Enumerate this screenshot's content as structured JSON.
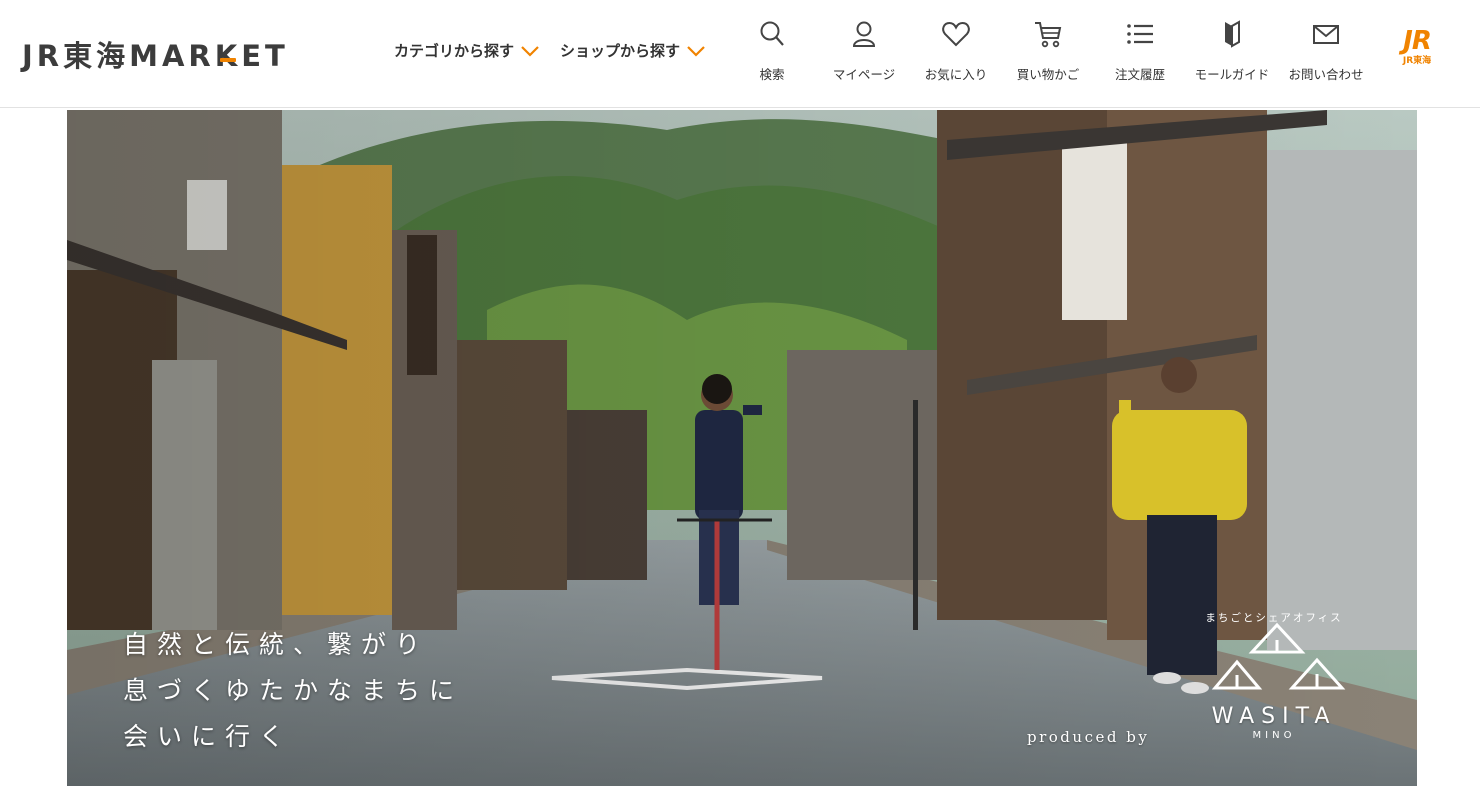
{
  "header": {
    "logo_text": "JR東海MARKET",
    "nav": [
      {
        "label": "カテゴリから探す"
      },
      {
        "label": "ショップから探す"
      }
    ],
    "icon_nav": [
      {
        "label": "検索",
        "icon": "search-icon"
      },
      {
        "label": "マイページ",
        "icon": "user-icon"
      },
      {
        "label": "お気に入り",
        "icon": "heart-icon"
      },
      {
        "label": "買い物かご",
        "icon": "cart-icon"
      },
      {
        "label": "注文履歴",
        "icon": "list-icon"
      },
      {
        "label": "モールガイド",
        "icon": "guide-icon"
      },
      {
        "label": "お問い合わせ",
        "icon": "mail-icon"
      }
    ],
    "jr_badge": {
      "mark": "JR",
      "sub": "JR東海"
    }
  },
  "hero": {
    "catch_lines": [
      "自然と伝統、繋がり",
      "息づくゆたかなまちに",
      "会いに行く"
    ],
    "produced_by": "produced by",
    "brand": {
      "arc": "まちごとシェアオフィス",
      "name": "WASITA",
      "sub": "MINO"
    }
  },
  "colors": {
    "accent": "#f08300",
    "text": "#333333",
    "header_bg": "#ffffff"
  }
}
